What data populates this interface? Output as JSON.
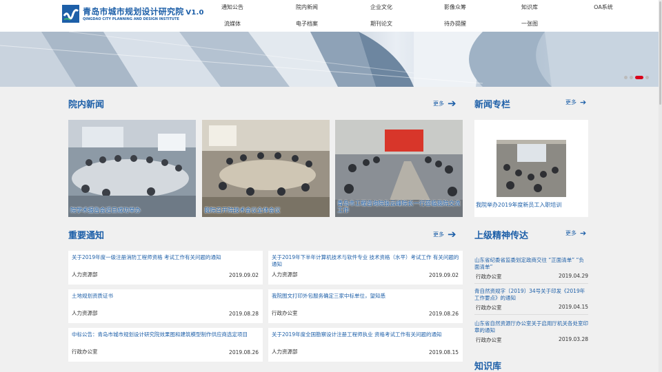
{
  "header": {
    "logo_cn": "青岛市城市规划设计研究院",
    "version": "V1.0",
    "logo_en": "QINGDAO CITY PLANNING AND DESIGN INSTITUTE",
    "nav_row1": [
      "通知公告",
      "院内新闻",
      "企业文化",
      "影像众筹",
      "知识库",
      "OA系统"
    ],
    "nav_row2": [
      "流媒体",
      "电子档案",
      "期刊论文",
      "待办提醒",
      "一张图"
    ]
  },
  "banner": {
    "slides": 4,
    "active_slide": 3
  },
  "news": {
    "title": "院内新闻",
    "more": "更多",
    "items": [
      {
        "caption": "院学术报告会近日成功举办"
      },
      {
        "caption": "我院召开院技术会议全体会议"
      },
      {
        "caption": "青岛市工程咨询院张云峰院长一行莅临我院交流工作"
      }
    ]
  },
  "column": {
    "title": "新闻专栏",
    "more": "更多",
    "caption": "我院举办2019年度新员工入职培训"
  },
  "notices": {
    "title": "重要通知",
    "more": "更多",
    "items": [
      {
        "title": "关于2019年度一级注册消防工程师资格 考试工作有关问题的通知",
        "dept": "人力资源部",
        "date": "2019.09.02"
      },
      {
        "title": "关于2019年下半年计算机技术与软件专业 技术资格（水平）考试工作 有关问题的通知",
        "dept": "人力资源部",
        "date": "2019.09.02"
      },
      {
        "title": "土地规划资质证书",
        "dept": "人力资源部",
        "date": "2019.08.28"
      },
      {
        "title": "我院图文打印外包服务确定三家中标单位，望知悉",
        "dept": "行政办公室",
        "date": "2019.08.26"
      },
      {
        "title": "中标公告：青岛市城市规划设计研究院效果图和建筑模型制作供应商选定项目",
        "dept": "行政办公室",
        "date": "2019.08.26"
      },
      {
        "title": "关于2019年度全国勘察设计注册工程师执业 资格考试工作有关问题的通知",
        "dept": "人力资源部",
        "date": "2019.08.15"
      }
    ]
  },
  "spirit": {
    "title": "上级精神传达",
    "more": "更多",
    "items": [
      {
        "title": "山东省纪委省监委划定政商交往 “正面清单” “负面清单”",
        "dept": "行政办公室",
        "date": "2019.04.29"
      },
      {
        "title": "青自然资规字〔2019〕34号关于印发《2019年工作要点》的通知",
        "dept": "行政办公室",
        "date": "2019.04.15"
      },
      {
        "title": "山东省自然资源厅办公室关于启用厅机关各处室印章的通知",
        "dept": "行政办公室",
        "date": "2019.03.28"
      }
    ]
  },
  "knowledge": {
    "title": "知识库"
  },
  "colors": {
    "brand": "#1d5fa8",
    "accent": "#d9001b"
  }
}
